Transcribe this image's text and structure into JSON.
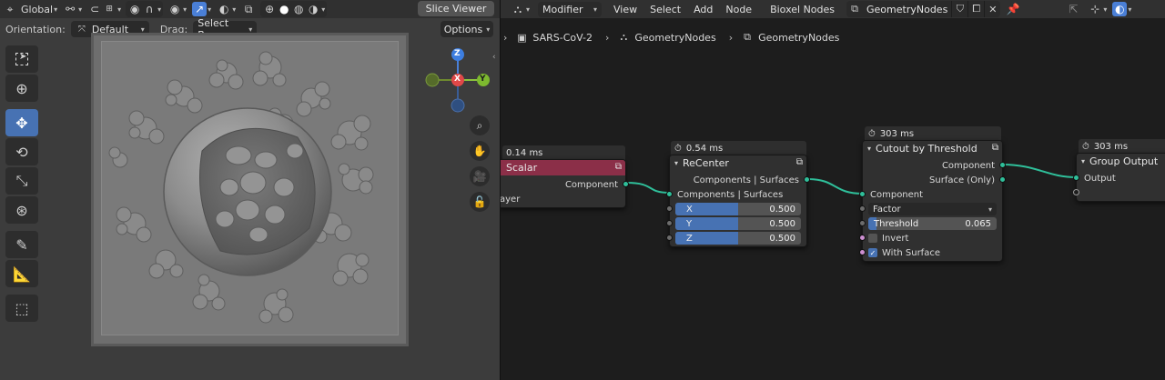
{
  "viewport": {
    "header": {
      "transform_orientation": "Global",
      "slice_viewer_label": "Slice Viewer"
    },
    "toolbar2": {
      "orientation_label": "Orientation:",
      "orientation_value": "Default",
      "drag_label": "Drag:",
      "drag_value": "Select Box",
      "options_label": "Options"
    },
    "tools": [
      "select-box",
      "cursor",
      "move",
      "rotate",
      "scale",
      "transform",
      "annotate",
      "measure",
      "add-cube"
    ],
    "gizmo": {
      "z": "Z",
      "x": "X",
      "y": "Y"
    }
  },
  "node_editor": {
    "header": {
      "menus": [
        "View",
        "Select",
        "Add",
        "Node",
        "Bioxel Nodes"
      ],
      "editor_type": "Modifier",
      "node_tree_name": "GeometryNodes"
    },
    "breadcrumb": [
      "SARS-CoV-2",
      "GeometryNodes",
      "GeometryNodes"
    ],
    "nodes": {
      "scalar": {
        "timing": "0.14 ms",
        "title": "Scalar",
        "output": "Component",
        "partial_row": "ayer"
      },
      "recenter": {
        "timing": "0.54 ms",
        "title": "ReCenter",
        "output": "Components | Surfaces",
        "input": "Components | Surfaces",
        "fields": [
          {
            "label": "X",
            "value": "0.500"
          },
          {
            "label": "Y",
            "value": "0.500"
          },
          {
            "label": "Z",
            "value": "0.500"
          }
        ]
      },
      "cutout": {
        "timing": "303 ms",
        "title": "Cutout by Threshold",
        "outputs": [
          "Component",
          "Surface (Only)"
        ],
        "input": "Component",
        "mode": "Factor",
        "threshold_label": "Threshold",
        "threshold_value": "0.065",
        "invert_label": "Invert",
        "with_surface_label": "With Surface"
      },
      "group_output": {
        "timing": "303 ms",
        "title": "Group Output",
        "input": "Output"
      }
    },
    "colors": {
      "link": "#2fbf9a",
      "scalar_header": "#8b2f48",
      "accent": "#4772b3"
    }
  }
}
